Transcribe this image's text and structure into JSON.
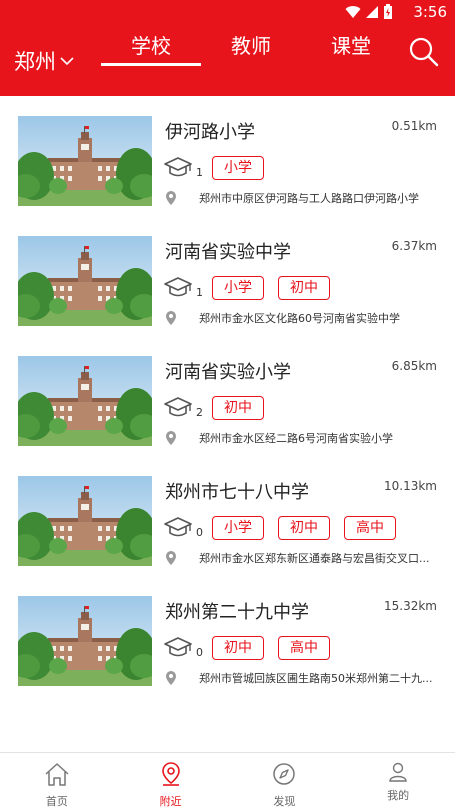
{
  "status": {
    "time": "3:56"
  },
  "header": {
    "city": "郑州",
    "tabs": [
      {
        "label": "学校",
        "active": true
      },
      {
        "label": "教师",
        "active": false
      },
      {
        "label": "课堂",
        "active": false
      }
    ]
  },
  "schools": [
    {
      "name": "伊河路小学",
      "distance": "0.51km",
      "teacher_count": "1",
      "levels": [
        "小学"
      ],
      "address": "郑州市中原区伊河路与工人路路口伊河路小学"
    },
    {
      "name": "河南省实验中学",
      "distance": "6.37km",
      "teacher_count": "1",
      "levels": [
        "小学",
        "初中"
      ],
      "address": "郑州市金水区文化路60号河南省实验中学"
    },
    {
      "name": "河南省实验小学",
      "distance": "6.85km",
      "teacher_count": "2",
      "levels": [
        "初中"
      ],
      "address": "郑州市金水区经二路6号河南省实验小学"
    },
    {
      "name": "郑州市七十八中学",
      "distance": "10.13km",
      "teacher_count": "0",
      "levels": [
        "小学",
        "初中",
        "高中"
      ],
      "address": "郑州市金水区郑东新区通泰路与宏昌街交叉口..."
    },
    {
      "name": "郑州第二十九中学",
      "distance": "15.32km",
      "teacher_count": "0",
      "levels": [
        "初中",
        "高中"
      ],
      "address": "郑州市管城回族区圃生路南50米郑州第二十九..."
    }
  ],
  "bottom_nav": [
    {
      "label": "首页",
      "icon": "home-icon",
      "active": false
    },
    {
      "label": "附近",
      "icon": "location-icon",
      "active": true
    },
    {
      "label": "发现",
      "icon": "compass-icon",
      "active": false
    },
    {
      "label": "我的",
      "icon": "user-icon",
      "active": false
    }
  ],
  "colors": {
    "brand": "#e8141c",
    "tag_border": "#e8141c"
  }
}
